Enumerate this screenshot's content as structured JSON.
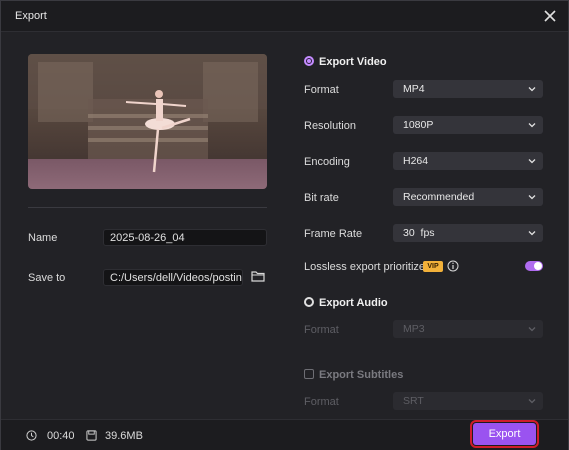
{
  "window": {
    "title": "Export"
  },
  "left": {
    "name_label": "Name",
    "name_value": "2025-08-26_04",
    "save_label": "Save to",
    "save_value": "C:/Users/dell/Videos/posting"
  },
  "video": {
    "section_label": "Export Video",
    "format": {
      "label": "Format",
      "value": "MP4"
    },
    "resolution": {
      "label": "Resolution",
      "value": "1080P"
    },
    "encoding": {
      "label": "Encoding",
      "value": "H264"
    },
    "bitrate": {
      "label": "Bit rate",
      "value": "Recommended"
    },
    "framerate": {
      "label": "Frame Rate",
      "value": "30",
      "unit": "fps"
    },
    "lossless": {
      "label": "Lossless export prioritized",
      "badge": "VIP",
      "enabled": true
    }
  },
  "audio": {
    "section_label": "Export Audio",
    "format": {
      "label": "Format",
      "value": "MP3"
    }
  },
  "subtitles": {
    "section_label": "Export Subtitles",
    "format": {
      "label": "Format",
      "value": "SRT"
    }
  },
  "footer": {
    "duration": "00:40",
    "size": "39.6MB",
    "export_label": "Export"
  },
  "colors": {
    "accent": "#9a53f0",
    "highlight_border": "#d01c2a",
    "vip": "#f2b13a"
  }
}
